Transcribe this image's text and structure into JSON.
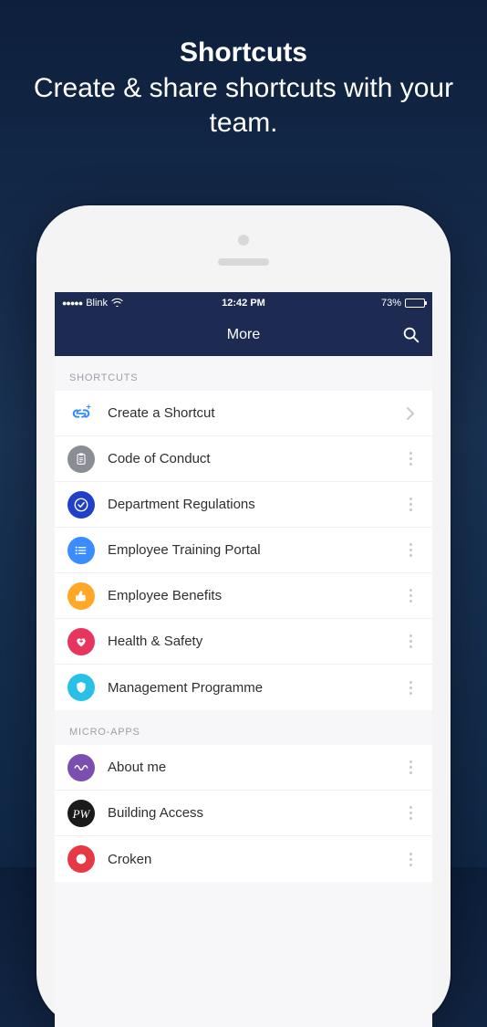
{
  "promo": {
    "title": "Shortcuts",
    "subtitle": "Create & share shortcuts with your team."
  },
  "status_bar": {
    "carrier": "Blink",
    "time": "12:42 PM",
    "battery_percent": "73%"
  },
  "nav": {
    "title": "More"
  },
  "sections": {
    "shortcuts": {
      "header": "SHORTCUTS",
      "items": [
        {
          "label": "Create a Shortcut",
          "icon": "link-plus",
          "color": "#2e8cff",
          "bg": "#ffffff",
          "action": "chevron"
        },
        {
          "label": "Code of Conduct",
          "icon": "clipboard",
          "color": "#ffffff",
          "bg": "#8a8d94",
          "action": "kebab"
        },
        {
          "label": "Department Regulations",
          "icon": "check-circle",
          "color": "#ffffff",
          "bg": "#2140c8",
          "action": "kebab"
        },
        {
          "label": "Employee Training Portal",
          "icon": "list",
          "color": "#ffffff",
          "bg": "#3a8cff",
          "action": "kebab"
        },
        {
          "label": "Employee Benefits",
          "icon": "thumbs-up",
          "color": "#ffffff",
          "bg": "#ffa726",
          "action": "kebab"
        },
        {
          "label": "Health & Safety",
          "icon": "heart-plus",
          "color": "#ffffff",
          "bg": "#e6355f",
          "action": "kebab"
        },
        {
          "label": "Management Programme",
          "icon": "shield",
          "color": "#ffffff",
          "bg": "#29c0e6",
          "action": "kebab"
        }
      ]
    },
    "microapps": {
      "header": "MICRO-APPS",
      "items": [
        {
          "label": "About me",
          "icon": "wave",
          "color": "#ffffff",
          "bg": "#7a4fb0",
          "action": "kebab"
        },
        {
          "label": "Building Access",
          "icon": "pw",
          "color": "#ffffff",
          "bg": "#1a1a1a",
          "action": "kebab"
        },
        {
          "label": "Croken",
          "icon": "generic",
          "color": "#ffffff",
          "bg": "#e63946",
          "action": "kebab"
        }
      ]
    }
  }
}
